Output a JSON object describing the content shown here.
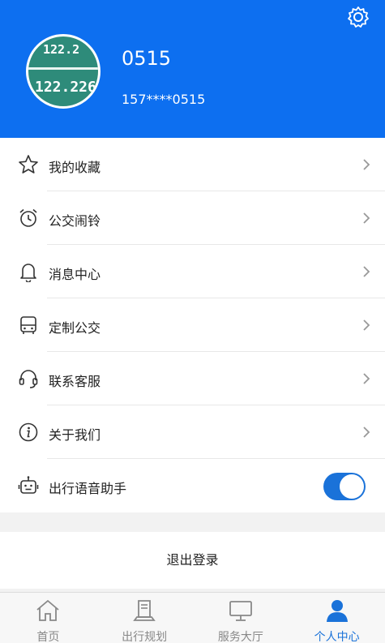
{
  "profile": {
    "avatar_text_1": "122.2",
    "avatar_text_2": "122.226",
    "name": "0515",
    "phone": "157****0515"
  },
  "menu": {
    "items": [
      {
        "label": "我的收藏",
        "icon": "star-icon"
      },
      {
        "label": "公交闹铃",
        "icon": "alarm-clock-icon"
      },
      {
        "label": "消息中心",
        "icon": "bell-icon"
      },
      {
        "label": "定制公交",
        "icon": "bus-icon"
      },
      {
        "label": "联系客服",
        "icon": "headset-icon"
      },
      {
        "label": "关于我们",
        "icon": "info-icon"
      },
      {
        "label": "出行语音助手",
        "icon": "robot-icon",
        "toggle_on": true
      }
    ]
  },
  "logout_label": "退出登录",
  "tabbar": {
    "tabs": [
      {
        "label": "首页",
        "icon": "home-icon"
      },
      {
        "label": "出行规划",
        "icon": "route-icon"
      },
      {
        "label": "服务大厅",
        "icon": "monitor-icon"
      },
      {
        "label": "个人中心",
        "icon": "person-icon",
        "active": true
      }
    ]
  },
  "colors": {
    "header_bg": "#0d6ff0",
    "accent": "#1a72d9",
    "tab_inactive": "#888888"
  }
}
